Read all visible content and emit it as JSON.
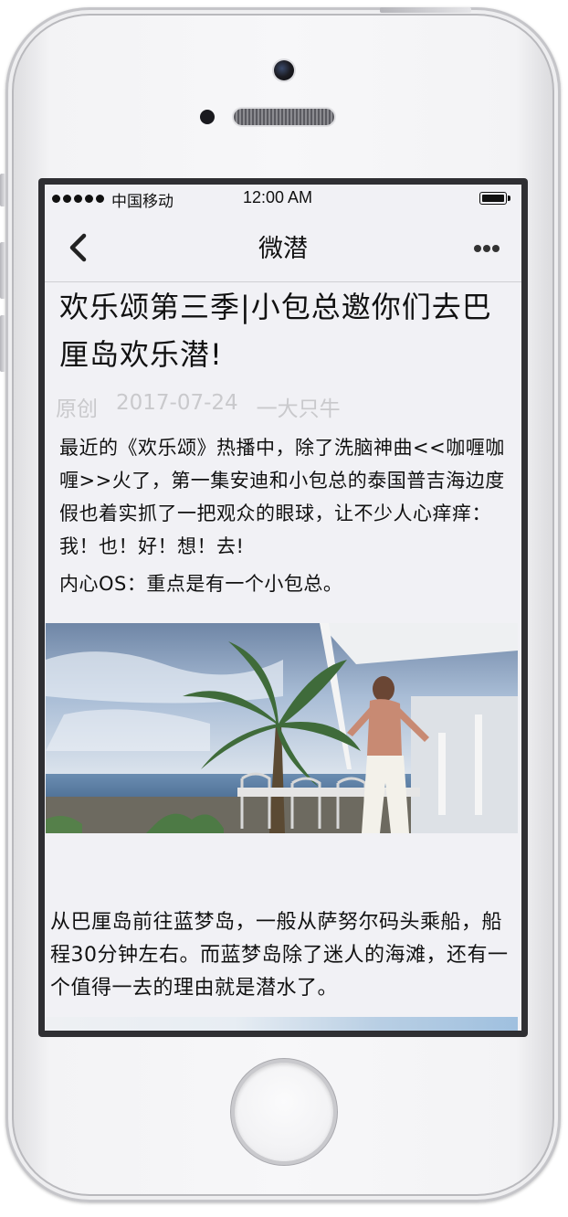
{
  "status_bar": {
    "carrier": "中国移动",
    "time": "12:00 AM"
  },
  "nav": {
    "title": "微潜"
  },
  "article": {
    "title": "欢乐颂第三季|小包总邀你们去巴厘岛欢乐潜!",
    "meta": {
      "tag": "原创",
      "date": "2017-07-24",
      "author": "一大只牛"
    },
    "paragraph_1": "最近的《欢乐颂》热播中，除了洗脑神曲<<咖喱咖喱>>火了，第一集安迪和小包总的泰国普吉海边度假也着实抓了一把观众的眼球，让不少人心痒痒：我！也！好！想！去!",
    "paragraph_2": "内心OS：重点是有一个小包总。",
    "paragraph_3": "从巴厘岛前往蓝梦岛，一般从萨努尔码头乘船，船程30分钟左右。而蓝梦岛除了迷人的海滩，还有一个值得一去的理由就是潜水了。"
  },
  "colors": {
    "screen_bg": "#f1f1f5",
    "meta_text": "#c9c9cc",
    "text": "#111111"
  }
}
